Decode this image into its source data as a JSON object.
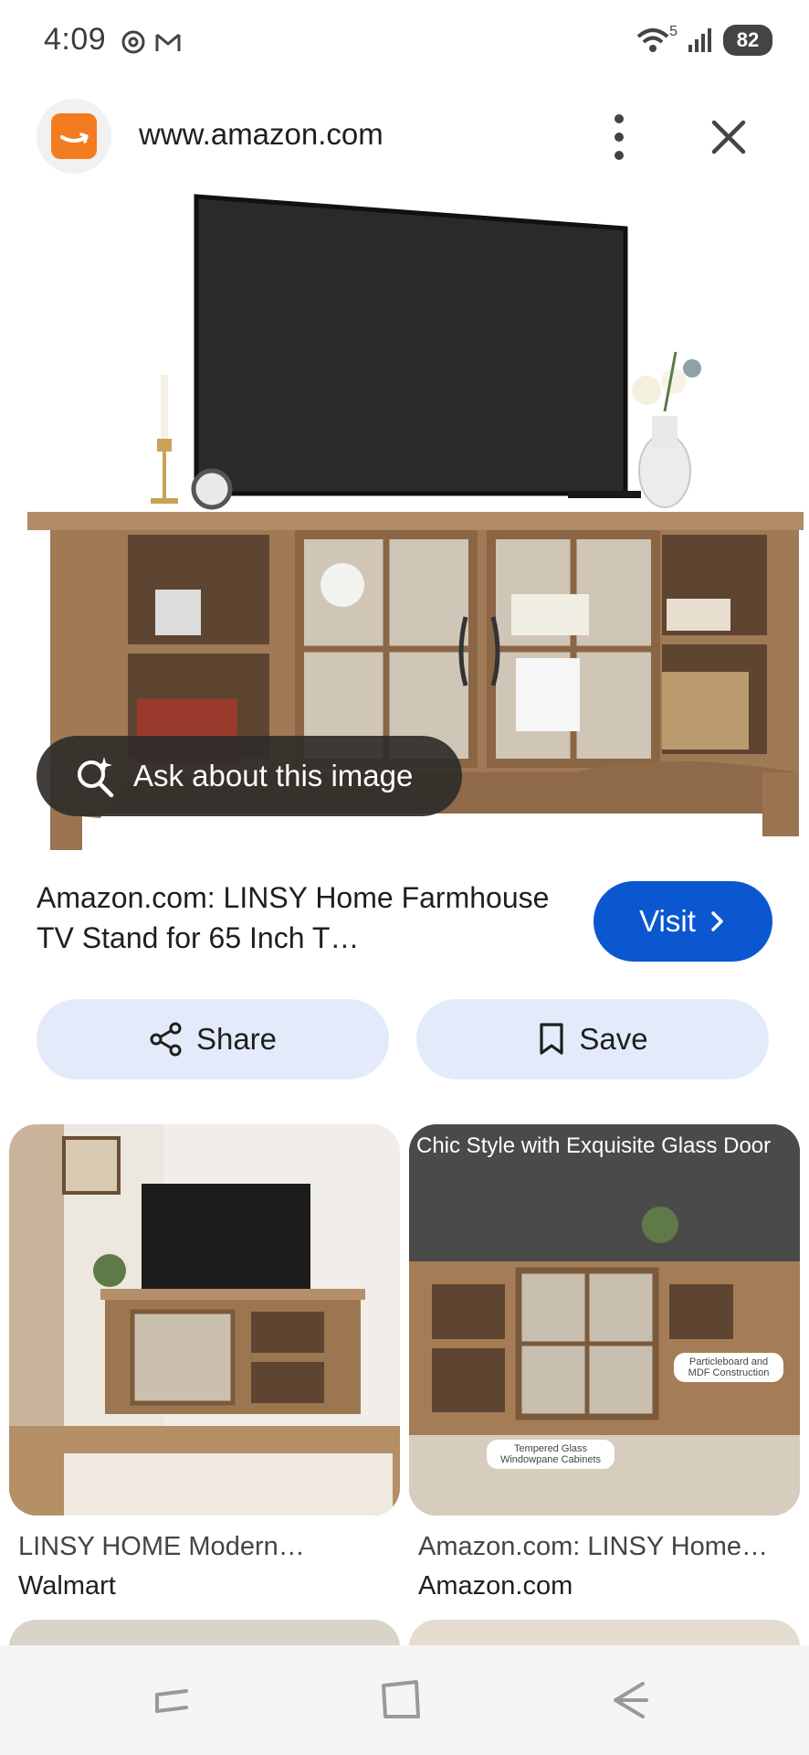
{
  "status_bar": {
    "time": "4:09",
    "battery": "82",
    "network_badge": "5"
  },
  "header": {
    "url": "www.amazon.com",
    "favicon_color": "#f47c20"
  },
  "hero": {
    "ask_label": "Ask about this image"
  },
  "result": {
    "title": "Amazon.com: LINSY Home Farmhouse TV Stand for 65 Inch T…",
    "visit_label": "Visit"
  },
  "actions": {
    "share_label": "Share",
    "save_label": "Save"
  },
  "related": [
    {
      "title": "LINSY HOME Modern…",
      "source": "Walmart"
    },
    {
      "title": "Amazon.com: LINSY Home…",
      "source": "Amazon.com",
      "overlay_heading": "Chic Style with Exquisite Glass Door",
      "callout_1": "Particleboard and MDF Construction",
      "callout_2": "Tempered Glass Windowpane Cabinets"
    }
  ],
  "colors": {
    "accent": "#0b57d0",
    "pill_bg": "#e3ebfa",
    "wood": "#a07a55"
  }
}
